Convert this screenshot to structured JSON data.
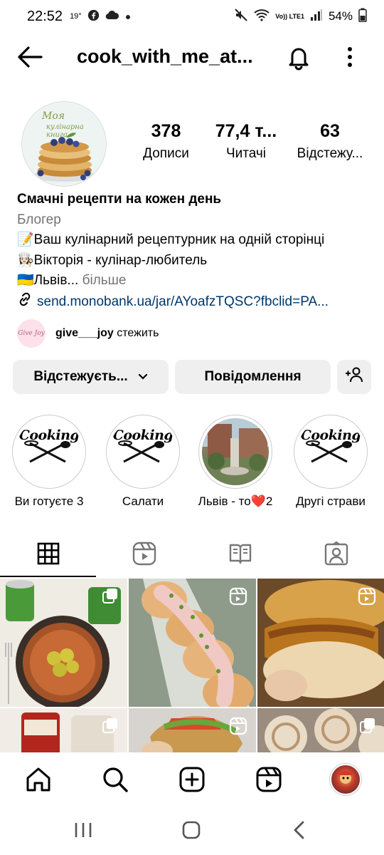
{
  "status_bar": {
    "time": "22:52",
    "temp": "19°",
    "network": "Vo)) LTE1",
    "battery": "54%"
  },
  "header": {
    "username": "cook_with_me_at..."
  },
  "profile": {
    "avatar_text_1": "Моя",
    "avatar_text_2": "кулінарна книга",
    "stats": [
      {
        "value": "378",
        "label": "Дописи"
      },
      {
        "value": "77,4 т...",
        "label": "Читачі"
      },
      {
        "value": "63",
        "label": "Відстежу..."
      }
    ],
    "name": "Смачні рецепти на кожен день",
    "category": "Блогер",
    "bio_line_1": "📝Ваш кулінарний рецептурник на одній сторінці",
    "bio_line_2": "👩🏻‍🍳Вікторія - кулінар-любитель",
    "bio_line_3": "🇺🇦Львів...",
    "bio_more": "більше",
    "link": "send.monobank.ua/jar/AYoafzTQSC?fbclid=PA...",
    "followed_by_avatar": "Give Joy",
    "followed_by_user": "give___joy",
    "followed_by_suffix": "стежить"
  },
  "buttons": {
    "following": "Відстежуєть...",
    "message": "Повідомлення"
  },
  "highlights": [
    {
      "label": "Ви готуєте 3",
      "text": "Cooking"
    },
    {
      "label": "Салати",
      "text": "Cooking"
    },
    {
      "label": "Львів - то❤️2",
      "text": ""
    },
    {
      "label": "Другі страви",
      "text": "Cooking"
    }
  ],
  "colors": {
    "accent_link": "#00376b",
    "muted": "#737373",
    "button_bg": "#efefef"
  }
}
